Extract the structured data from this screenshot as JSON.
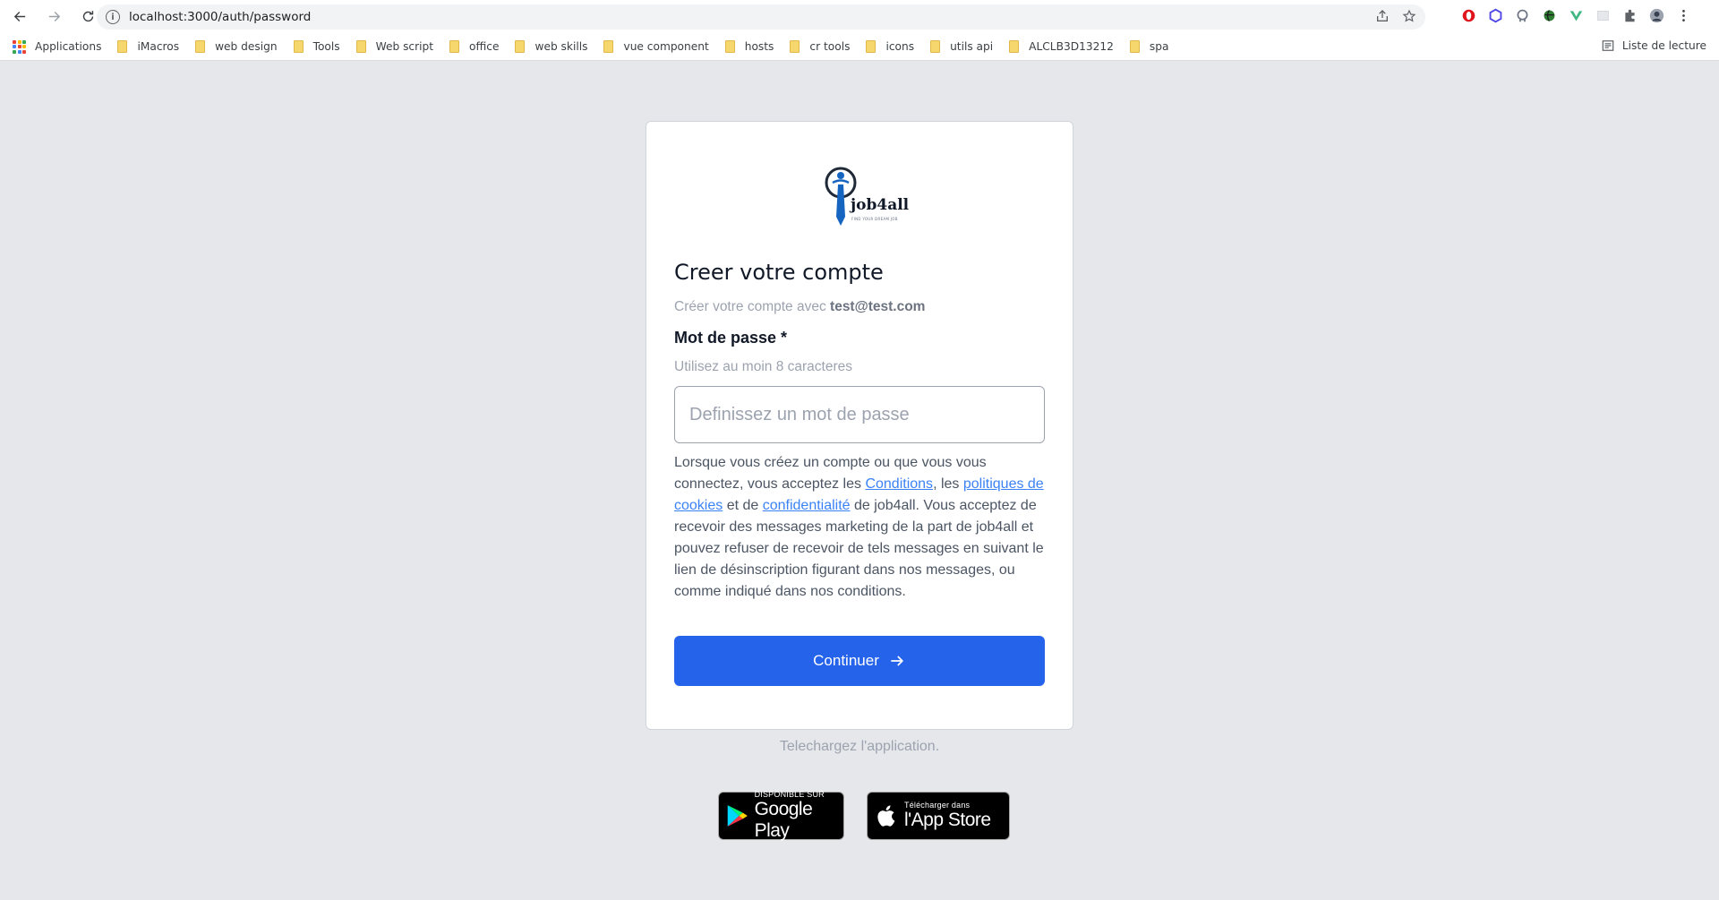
{
  "browser": {
    "url": "localhost:3000/auth/password",
    "bookmarks": [
      "Applications",
      "iMacros",
      "web design",
      "Tools",
      "Web script",
      "office",
      "web skills",
      "vue component",
      "hosts",
      "cr tools",
      "icons",
      "utils api",
      "ALCLB3D13212",
      "spa"
    ],
    "reading_list": "Liste de lecture"
  },
  "logo": {
    "brand": "job4all",
    "tagline": "FIND YOUR DREAM JOB"
  },
  "form": {
    "title": "Creer votre compte",
    "subtitle_prefix": "Créer votre compte avec",
    "email": "test@test.com",
    "password_label": "Mot de passe *",
    "password_hint": "Utilisez au moin 8 caracteres",
    "password_placeholder": "Definissez un mot de passe",
    "password_value": "",
    "legal_1": "Lorsque vous créez un compte ou que vous vous connectez, vous acceptez les ",
    "link_conditions": "Conditions",
    "legal_2": ", les ",
    "link_cookies": "politiques de cookies",
    "legal_3": " et de ",
    "link_privacy": "confidentialité",
    "legal_4": " de job4all. Vous acceptez de recevoir des messages marketing de la part de job4all et pouvez refuser de recevoir de tels messages en suivant le lien de désinscription figurant dans nos messages, ou comme indiqué dans nos conditions.",
    "continue_label": "Continuer"
  },
  "download": {
    "text": "Telechargez l'application.",
    "google_small": "DISPONIBLE SUR",
    "google_big": "Google Play",
    "apple_small": "Télécharger dans",
    "apple_big": "l'App Store"
  },
  "colors": {
    "primary": "#2563eb",
    "link": "#3b82f6",
    "page_bg": "#e5e7eb"
  }
}
